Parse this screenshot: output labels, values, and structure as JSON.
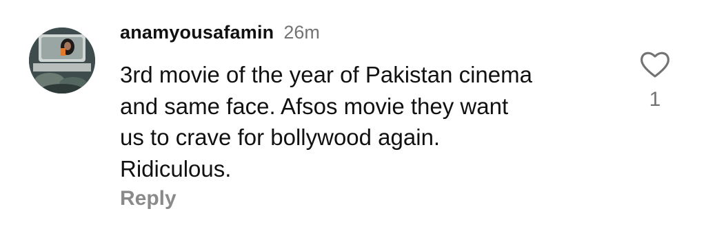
{
  "comment": {
    "username": "anamyousafamin",
    "timestamp": "26m",
    "lines": [
      "3rd movie of the year of Pakistan cinema",
      "and same face. Afsos movie they want",
      "us to crave for bollywood again.",
      "Ridiculous."
    ],
    "reply_label": "Reply",
    "like_count": "1",
    "like_icon": "heart-outline-icon"
  }
}
